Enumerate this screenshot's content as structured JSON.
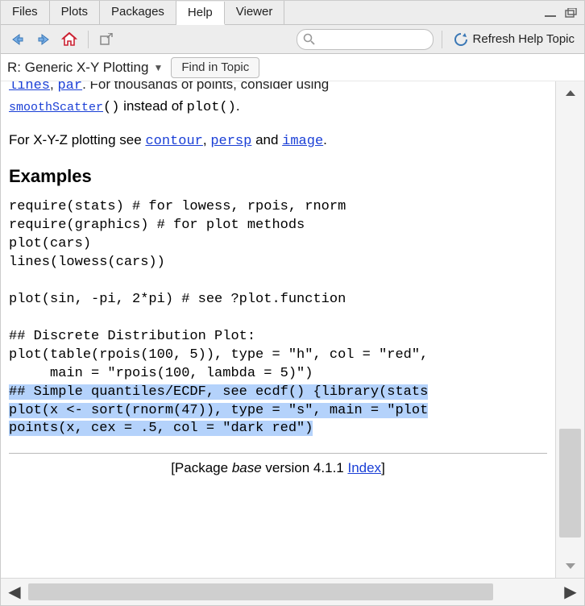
{
  "tabs": {
    "files": "Files",
    "plots": "Plots",
    "packages": "Packages",
    "help": "Help",
    "viewer": "Viewer"
  },
  "toolbar": {
    "search_placeholder": "",
    "refresh_label": "Refresh Help Topic"
  },
  "crumb": {
    "title": "R: Generic X-Y Plotting",
    "find_label": "Find in Topic"
  },
  "body": {
    "line1_pre": "lines",
    "line1_sep": ", ",
    "line1_par": "par",
    "line1_post": ". For thousands of points, consider using",
    "line2_link": "smoothScatter",
    "line2_mid": "()",
    "line2_txt": " instead of ",
    "line2_code": "plot()",
    "line2_end": ".",
    "xyz_pre": "For X-Y-Z plotting see ",
    "xyz_l1": "contour",
    "xyz_c1": ", ",
    "xyz_l2": "persp",
    "xyz_c2": " and ",
    "xyz_l3": "image",
    "xyz_end": ".",
    "examples_h": "Examples",
    "code_block": "require(stats) # for lowess, rpois, rnorm\nrequire(graphics) # for plot methods\nplot(cars)\nlines(lowess(cars))\n\nplot(sin, -pi, 2*pi) # see ?plot.function\n\n## Discrete Distribution Plot:\nplot(table(rpois(100, 5)), type = \"h\", col = \"red\",\n     main = \"rpois(100, lambda = 5)\")\n",
    "sel_block": "## Simple quantiles/ECDF, see ecdf() {library(stats\nplot(x <- sort(rnorm(47)), type = \"s\", main = \"plot\npoints(x, cex = .5, col = \"dark red\")",
    "pkg_pre": "[Package ",
    "pkg_name": "base",
    "pkg_mid": " version 4.1.1 ",
    "pkg_link": "Index",
    "pkg_end": "]"
  }
}
